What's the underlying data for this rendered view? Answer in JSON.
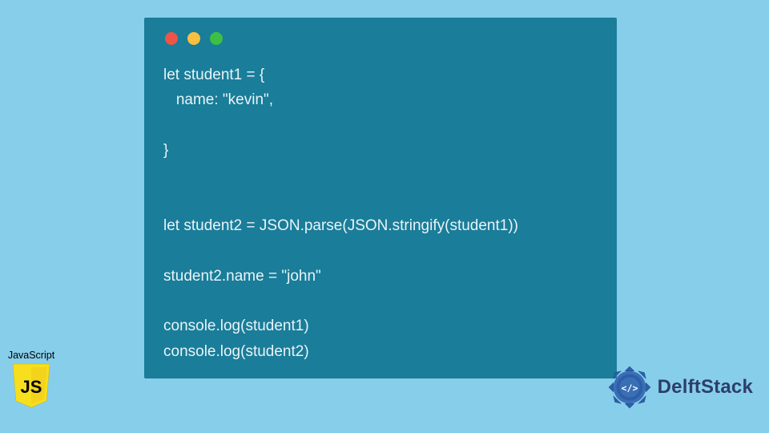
{
  "code_window": {
    "lines": [
      "let student1 = {",
      "   name: \"kevin\",",
      "",
      "}",
      "",
      "",
      "let student2 = JSON.parse(JSON.stringify(student1))",
      "",
      "student2.name = \"john\"",
      "",
      "console.log(student1)",
      "console.log(student2)"
    ]
  },
  "js_badge": {
    "label": "JavaScript",
    "logo_text": "JS"
  },
  "brand": {
    "name": "DelftStack"
  },
  "colors": {
    "page_bg": "#87ceeb",
    "window_bg": "#1a7d99",
    "code_text": "#e8f4f8",
    "js_yellow": "#f7df1e",
    "brand_blue": "#2c3e6e"
  }
}
